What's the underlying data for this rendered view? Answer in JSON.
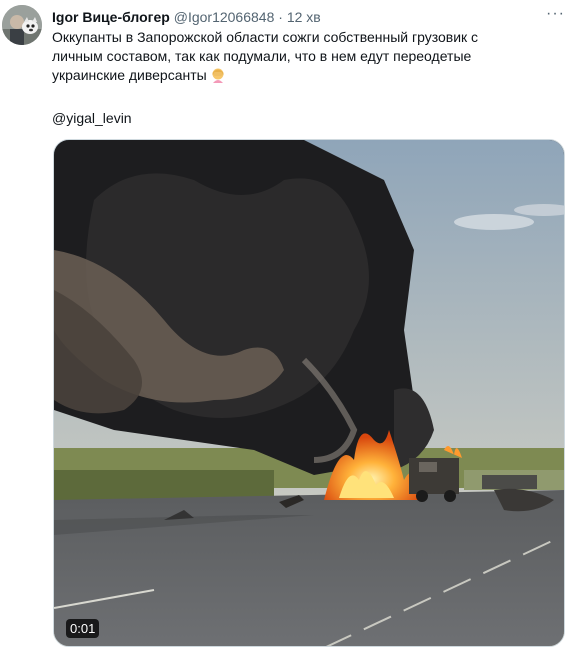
{
  "tweet": {
    "author_name": "Igor Вице-блогер",
    "handle": "@Igor12066848",
    "separator": "·",
    "time": "12 хв",
    "more_label": "···",
    "text_line1": "Оккупанты в Запорожской области сожги собственный грузовик с",
    "text_line2": "личным составом, так как подумали, что в нем едут переодетые",
    "text_line3": "украинские диверсанты",
    "mention": "@yigal_levin",
    "video_duration": "0:01"
  },
  "colors": {
    "text": "#0f1419",
    "secondary": "#536471",
    "border": "#cfd9de"
  },
  "icons": [
    "avatar",
    "person-facepalming-emoji",
    "more-icon"
  ]
}
